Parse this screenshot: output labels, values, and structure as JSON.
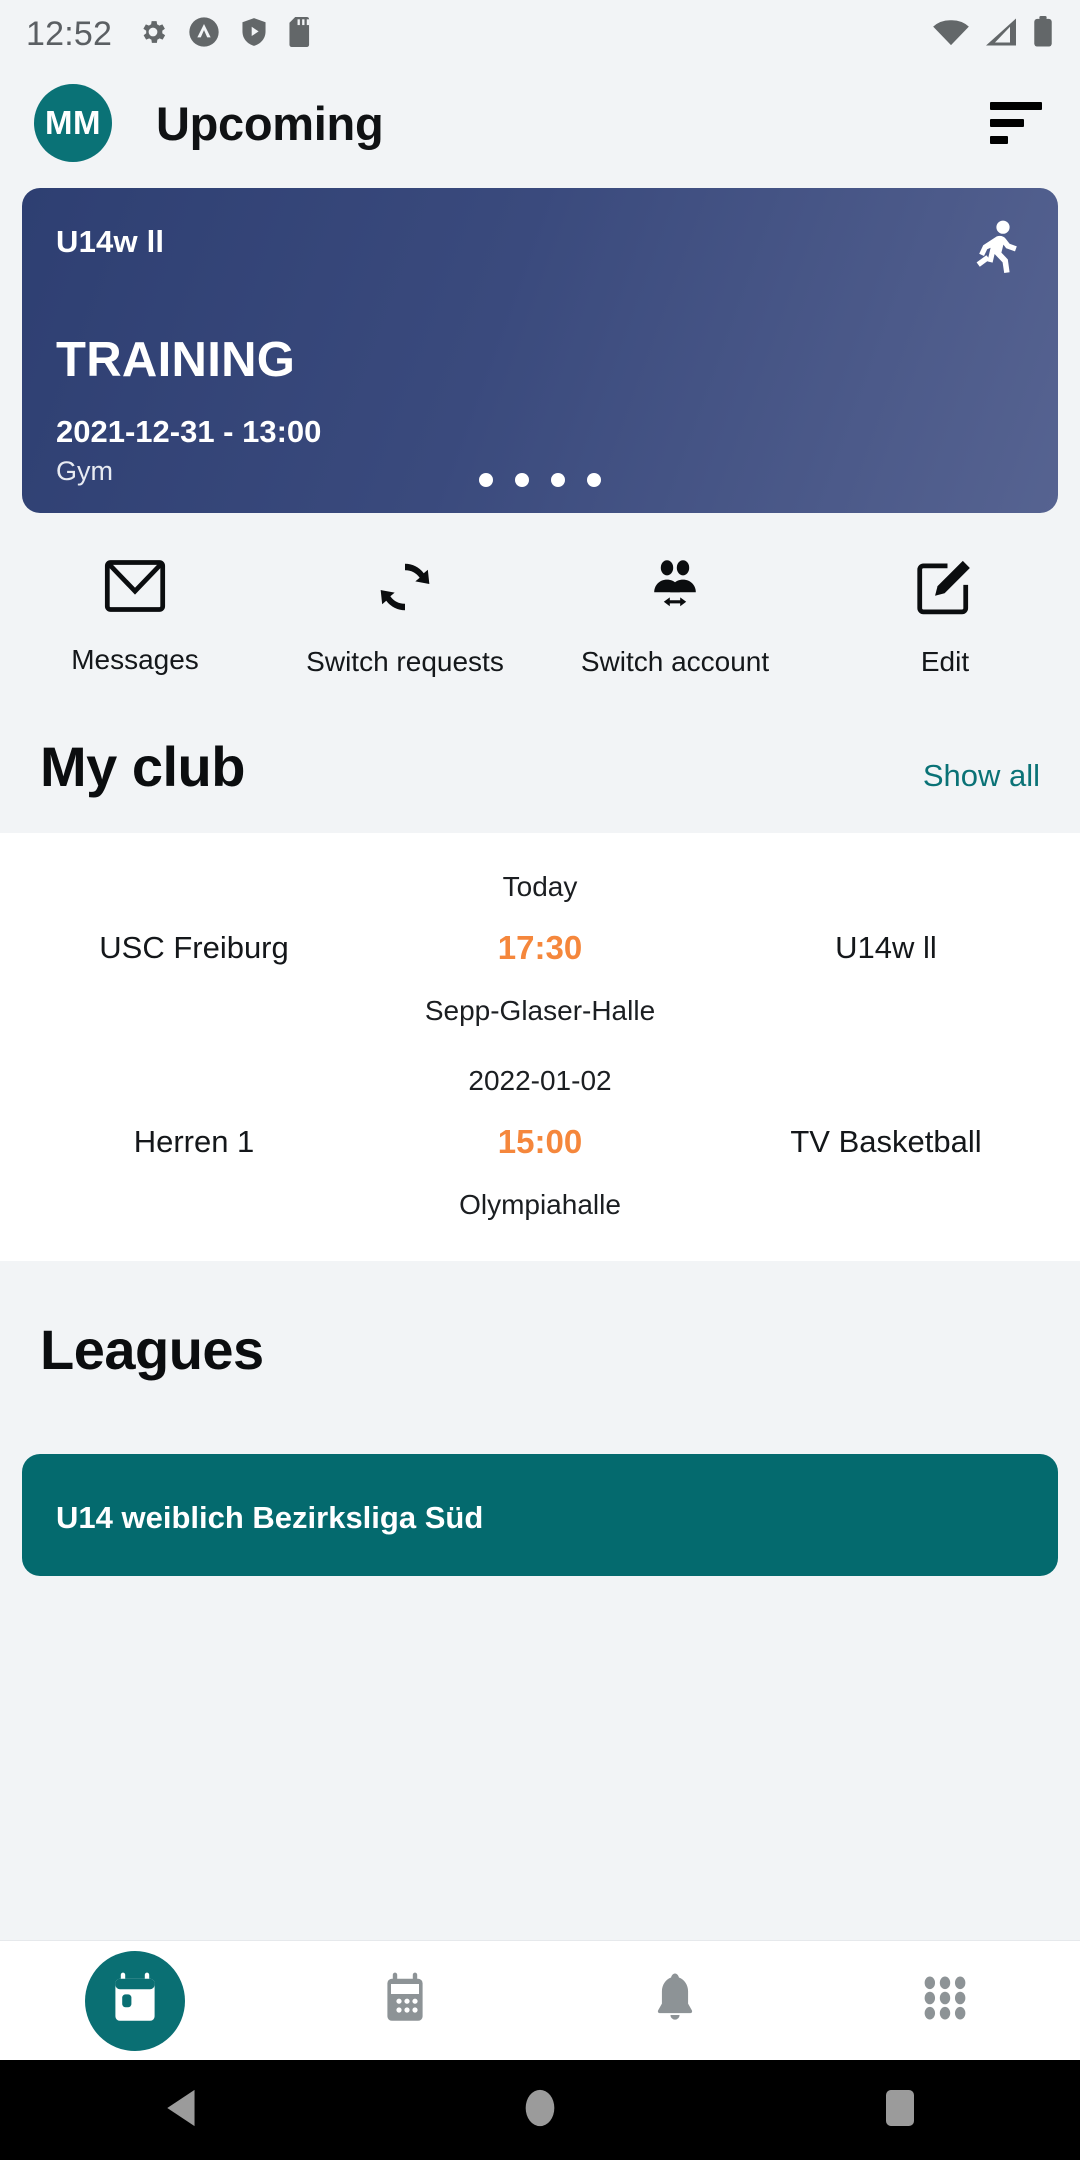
{
  "status_bar": {
    "time": "12:52",
    "left_icons": [
      "gear-icon",
      "app-circle-icon",
      "shield-play-icon",
      "sd-card-icon"
    ],
    "right_icons": [
      "wifi-icon",
      "cellular-signal-icon",
      "battery-icon"
    ]
  },
  "app_bar": {
    "avatar_initials": "MM",
    "title": "Upcoming",
    "menu_icon": "sort-filter-icon"
  },
  "hero_card": {
    "team": "U14w ll",
    "type": "TRAINING",
    "datetime": "2021-12-31 - 13:00",
    "venue": "Gym",
    "sport_icon": "running-person-icon",
    "page_dots": 4,
    "active_dot": 0,
    "gradient_from": "#2e3f72",
    "gradient_to": "#566391"
  },
  "quick_actions": [
    {
      "icon": "mail-icon",
      "label": "Messages"
    },
    {
      "icon": "refresh-icon",
      "label": "Switch requests"
    },
    {
      "icon": "people-switch-icon",
      "label": "Switch account"
    },
    {
      "icon": "edit-pencil-icon",
      "label": "Edit"
    }
  ],
  "my_club": {
    "title": "My club",
    "show_all": "Show all",
    "matches": [
      {
        "date": "Today",
        "home": "USC Freiburg",
        "time": "17:30",
        "away": "U14w ll",
        "venue": "Sepp-Glaser-Halle"
      },
      {
        "date": "2022-01-02",
        "home": "Herren 1",
        "time": "15:00",
        "away": "TV Basketball",
        "venue": "Olympiahalle"
      }
    ]
  },
  "leagues": {
    "title": "Leagues",
    "cards": [
      {
        "name": "U14 weiblich Bezirksliga Süd"
      }
    ]
  },
  "bottom_nav": [
    {
      "icon": "calendar-event-icon",
      "active": true
    },
    {
      "icon": "calendar-month-icon",
      "active": false
    },
    {
      "icon": "bell-icon",
      "active": false
    },
    {
      "icon": "grid-apps-icon",
      "active": false
    }
  ],
  "system_nav": [
    {
      "icon": "back-triangle-icon"
    },
    {
      "icon": "home-circle-icon"
    },
    {
      "icon": "recents-square-icon"
    }
  ],
  "colors": {
    "brand_teal": "#0a7276",
    "accent_orange": "#f5873c",
    "page_bg": "#f2f4f6",
    "card_bg": "#ffffff"
  }
}
